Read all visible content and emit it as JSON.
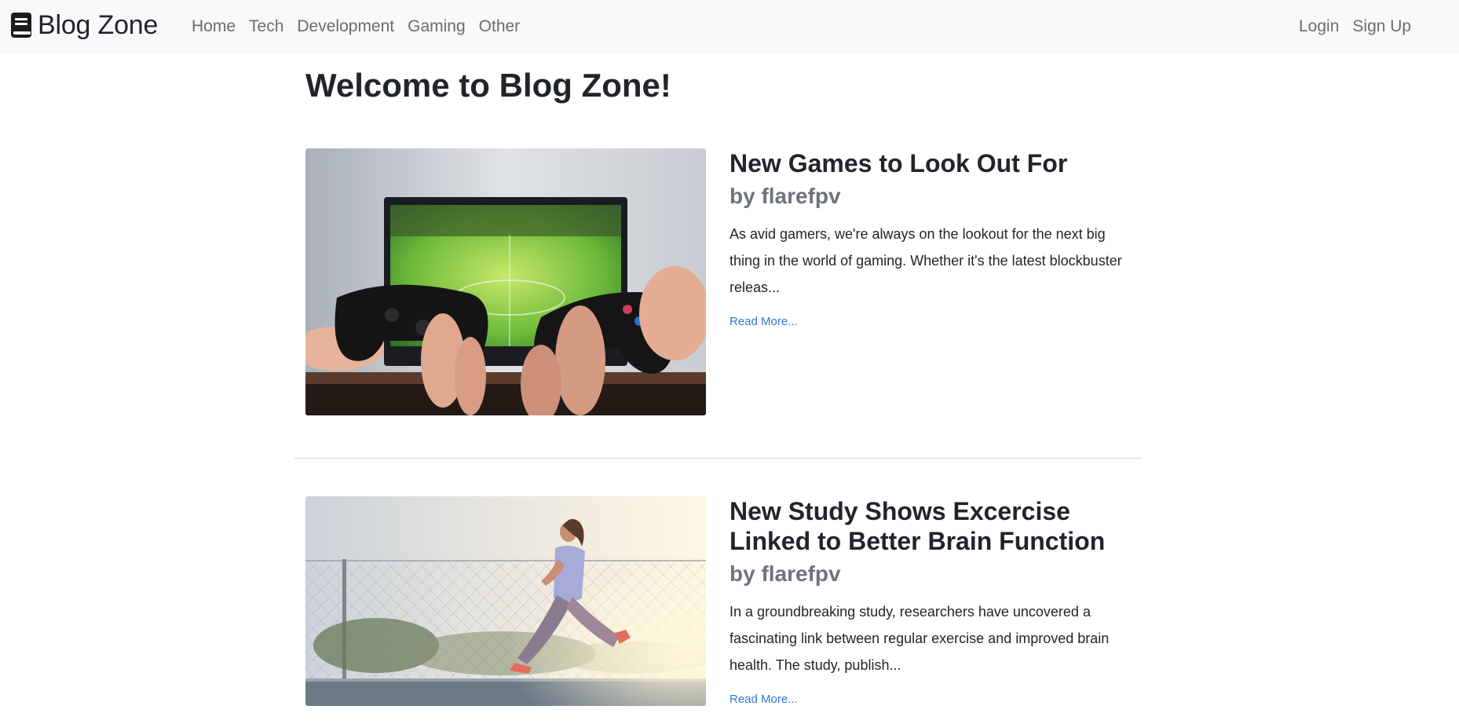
{
  "navbar": {
    "brand": "Blog Zone",
    "links": [
      {
        "label": "Home"
      },
      {
        "label": "Tech"
      },
      {
        "label": "Development"
      },
      {
        "label": "Gaming"
      },
      {
        "label": "Other"
      }
    ],
    "auth": {
      "login": "Login",
      "signup": "Sign Up"
    }
  },
  "main": {
    "title": "Welcome to Blog Zone!",
    "posts": [
      {
        "title": "New Games to Look Out For",
        "author": "by flarefpv",
        "excerpt": "As avid gamers, we're always on the lookout for the next big thing in the world of gaming. Whether it's the latest blockbuster releas...",
        "read_more": "Read More...",
        "image": "game-controllers-image"
      },
      {
        "title": "New Study Shows Excercise Linked to Better Brain Function",
        "author": "by flarefpv",
        "excerpt": "In a groundbreaking study, researchers have uncovered a fascinating link between regular exercise and improved brain health. The study, publish...",
        "read_more": "Read More...",
        "image": "woman-running-image"
      }
    ]
  },
  "colors": {
    "navbar_bg": "#f8f9fa",
    "nav_link": "#6c6c6c",
    "link_accent": "#2f78d8",
    "muted": "#6c757d",
    "text": "#212529"
  }
}
